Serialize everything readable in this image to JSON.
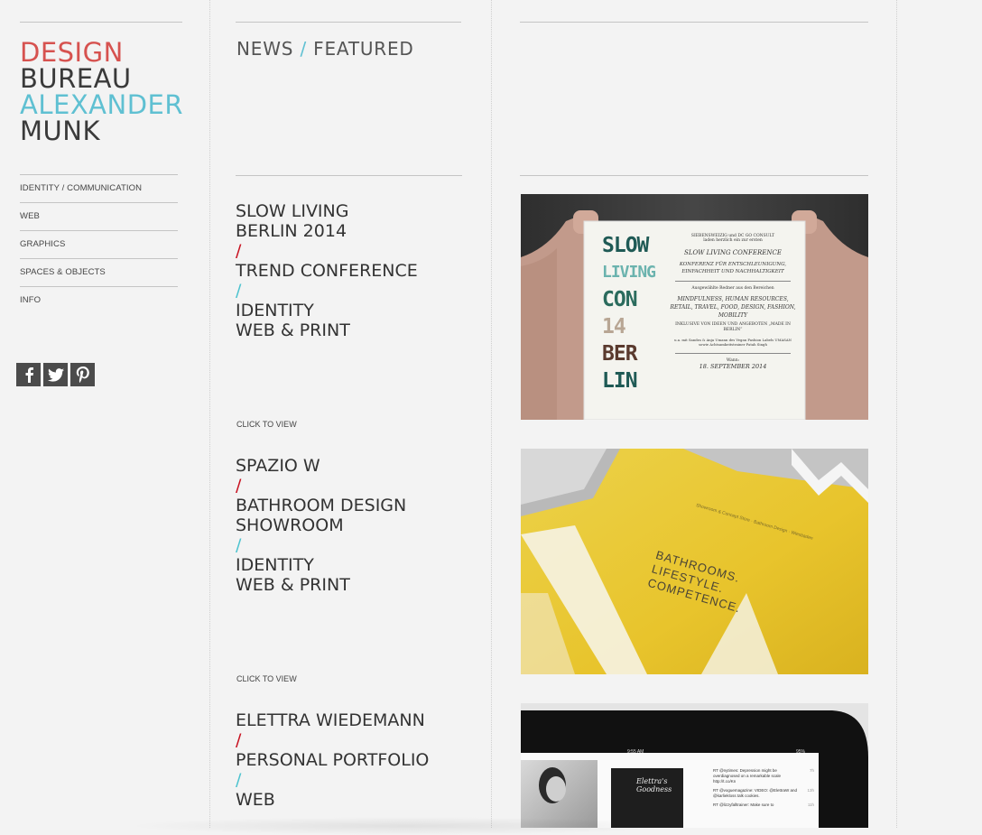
{
  "logo": {
    "line1": "DESIGN",
    "line2": "BUREAU",
    "line3": "ALEXANDER",
    "line4": "MUNK",
    "colors": {
      "red": "#d6524f",
      "blue": "#5fc0d2",
      "dark": "#3a3a3a"
    }
  },
  "nav": {
    "items": [
      {
        "label": "IDENTITY / COMMUNICATION"
      },
      {
        "label": "WEB"
      },
      {
        "label": "GRAPHICS"
      },
      {
        "label": "SPACES & OBJECTS"
      },
      {
        "label": "INFO"
      }
    ]
  },
  "social": {
    "icons": [
      "facebook-icon",
      "twitter-icon",
      "pinterest-icon"
    ]
  },
  "section": {
    "part1": "NEWS",
    "separator": "/",
    "part2": "FEATURED"
  },
  "projects": [
    {
      "title_lines": [
        "SLOW LIVING",
        "BERLIN 2014"
      ],
      "slash1": "/",
      "type_lines": [
        "TREND CONFERENCE"
      ],
      "slash2": "/",
      "category_lines": [
        "IDENTITY",
        "WEB & PRINT"
      ],
      "cta": "CLICK TO VIEW",
      "poster": {
        "organizers": "SIEBENSWEIZIG und DC GO CONSULT",
        "invite": "laden herzlich ein zur ersten",
        "title": "SLOW LIVING CONFERENCE",
        "subtitle": "KONFERENZ FÜR ENTSCHLEUNIGUNG, EINFACHHEIT UND NACHHALTIGKEIT",
        "topics_intro": "Ausgewählte Redner aus den Bereichen",
        "topics": "MINDFULNESS, HUMAN RESOURCES, RETAIL, TRAVEL, FOOD, DESIGN, FASHION, MOBILITY",
        "made_in": "INKLUSIVE VON IDEEN UND ANGEBOTEN „MADE IN BERLIN“",
        "speakers": "u.a. mit Sandra & Anja Umann des Vegan Fashion Labels UMASAN sowie Achtsamkeitstrainer Patah Singh",
        "when_label": "Wann:",
        "date": "18. SEPTEMBER 2014",
        "stencil": [
          "SLOW",
          "LIVING",
          "CON",
          "14",
          "BER",
          "LIN"
        ]
      }
    },
    {
      "title_lines": [
        "SPAZIO W"
      ],
      "slash1": "/",
      "type_lines": [
        "BATHROOM DESIGN",
        "SHOWROOM"
      ],
      "slash2": "/",
      "category_lines": [
        "IDENTITY",
        "WEB & PRINT"
      ],
      "cta": "CLICK TO VIEW",
      "card": {
        "headline": [
          "BATHROOMS.",
          "LIFESTYLE.",
          "COMPETENCE."
        ],
        "small_text": "Showroom & Concept Store · Bathroom Design · Wiesbaden"
      }
    },
    {
      "title_lines": [
        "ELETTRA WIEDEMANN"
      ],
      "slash1": "/",
      "type_lines": [
        "PERSONAL PORTFOLIO"
      ],
      "slash2": "/",
      "category_lines": [
        "WEB"
      ],
      "tablet": {
        "time": "9:55 AM",
        "battery": "95%",
        "blog_title": "Elettra's Goodness",
        "tweets": [
          "RT @nytimes: Depression might be overdiagnosed on a remarkable scale http://t.co/Kn",
          "RT @voguemagazine: VIDEO: @ElettraW and @karliekloss talk cookies.",
          "RT @lizzyfalltrainer: Make sure to"
        ],
        "tweet_meta": [
          "7h",
          "13h",
          "11h",
          "13h"
        ]
      }
    }
  ],
  "accent_colors": {
    "red_slash": "#c8101f",
    "blue_slash": "#4cc3cf"
  }
}
